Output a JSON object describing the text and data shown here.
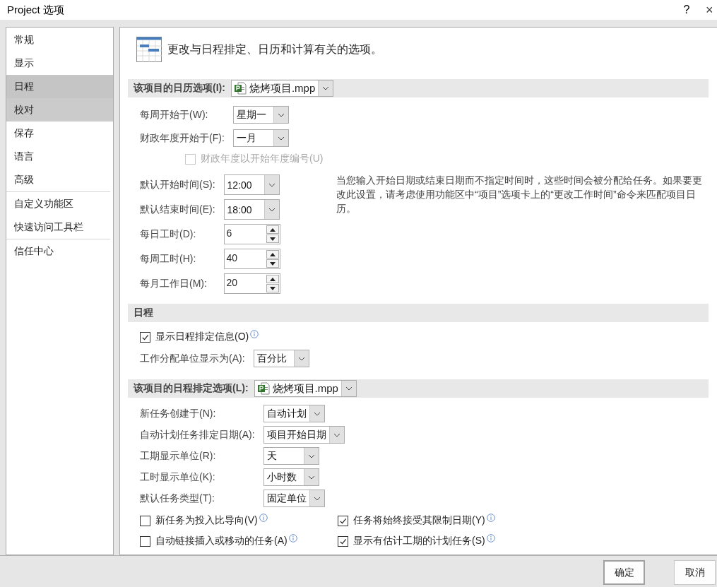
{
  "window": {
    "title": "Project 选项",
    "help": "?",
    "close": "×"
  },
  "sidebar": {
    "groups": [
      {
        "items": [
          {
            "label": "常规",
            "selected": false,
            "hovered": false
          },
          {
            "label": "显示",
            "selected": false,
            "hovered": false
          },
          {
            "label": "日程",
            "selected": true,
            "hovered": false
          },
          {
            "label": "校对",
            "selected": false,
            "hovered": true
          },
          {
            "label": "保存",
            "selected": false,
            "hovered": false
          },
          {
            "label": "语言",
            "selected": false,
            "hovered": false
          },
          {
            "label": "高级",
            "selected": false,
            "hovered": false
          }
        ]
      },
      {
        "items": [
          {
            "label": "自定义功能区",
            "selected": false,
            "hovered": false
          },
          {
            "label": "快速访问工具栏",
            "selected": false,
            "hovered": false
          }
        ]
      },
      {
        "items": [
          {
            "label": "信任中心",
            "selected": false,
            "hovered": false
          }
        ]
      }
    ]
  },
  "panel": {
    "heading": "更改与日程排定、日历和计算有关的选项。",
    "sections": [
      {
        "title": "该项目的日历选项(I):",
        "project": "烧烤项目.mpp",
        "items": [
          {
            "kind": "combos",
            "rows": [
              {
                "label": "每周开始于(W):",
                "value": "星期一"
              },
              {
                "label": "财政年度开始于(F):",
                "value": "一月"
              }
            ]
          },
          {
            "kind": "check",
            "label": "财政年度以开始年度编号(U)",
            "checked": false,
            "disabled": true,
            "info": false
          },
          {
            "kind": "block",
            "note": "当您输入开始日期或结束日期而不指定时间时，这些时间会被分配给任务。如果要更改此设置，请考虑使用功能区中“项目”选项卡上的“更改工作时间”命令来匹配项目日历。",
            "rows": [
              {
                "kind": "combo",
                "label": "默认开始时间(S):",
                "value": "12:00"
              },
              {
                "kind": "combo",
                "label": "默认结束时间(E):",
                "value": "18:00"
              },
              {
                "kind": "spin",
                "label": "每日工时(D):",
                "value": "6"
              },
              {
                "kind": "spin",
                "label": "每周工时(H):",
                "value": "40"
              },
              {
                "kind": "spin",
                "label": "每月工作日(M):",
                "value": "20"
              }
            ]
          }
        ]
      },
      {
        "title": "日程",
        "items": [
          {
            "kind": "check",
            "label": "显示日程排定信息(O)",
            "checked": true,
            "disabled": false,
            "info": true
          },
          {
            "kind": "combos",
            "rows": [
              {
                "label": "工作分配单位显示为(A):",
                "value": "百分比"
              }
            ]
          }
        ]
      },
      {
        "title": "该项目的日程排定选项(L):",
        "project": "烧烤项目.mpp",
        "items": [
          {
            "kind": "combos",
            "rows": [
              {
                "label": "新任务创建于(N):",
                "value": "自动计划"
              },
              {
                "label": "自动计划任务排定日期(A):",
                "value": "项目开始日期"
              },
              {
                "label": "工期显示单位(R):",
                "value": "天"
              },
              {
                "label": "工时显示单位(K):",
                "value": "小时数"
              },
              {
                "label": "默认任务类型(T):",
                "value": "固定单位"
              }
            ]
          },
          {
            "kind": "pair",
            "left": {
              "label": "新任务为投入比导向(V)",
              "checked": false,
              "info": true
            },
            "right": {
              "label": "任务将始终接受其限制日期(Y)",
              "checked": true,
              "info": true
            }
          },
          {
            "kind": "pair",
            "left": {
              "label": "自动链接插入或移动的任务(A)",
              "checked": false,
              "info": true
            },
            "right": {
              "label": "显示有估计工期的计划任务(S)",
              "checked": true,
              "info": true
            }
          }
        ]
      }
    ]
  },
  "buttons": [
    {
      "label": "确定",
      "default": true
    },
    {
      "label": "取消",
      "default": false
    }
  ]
}
